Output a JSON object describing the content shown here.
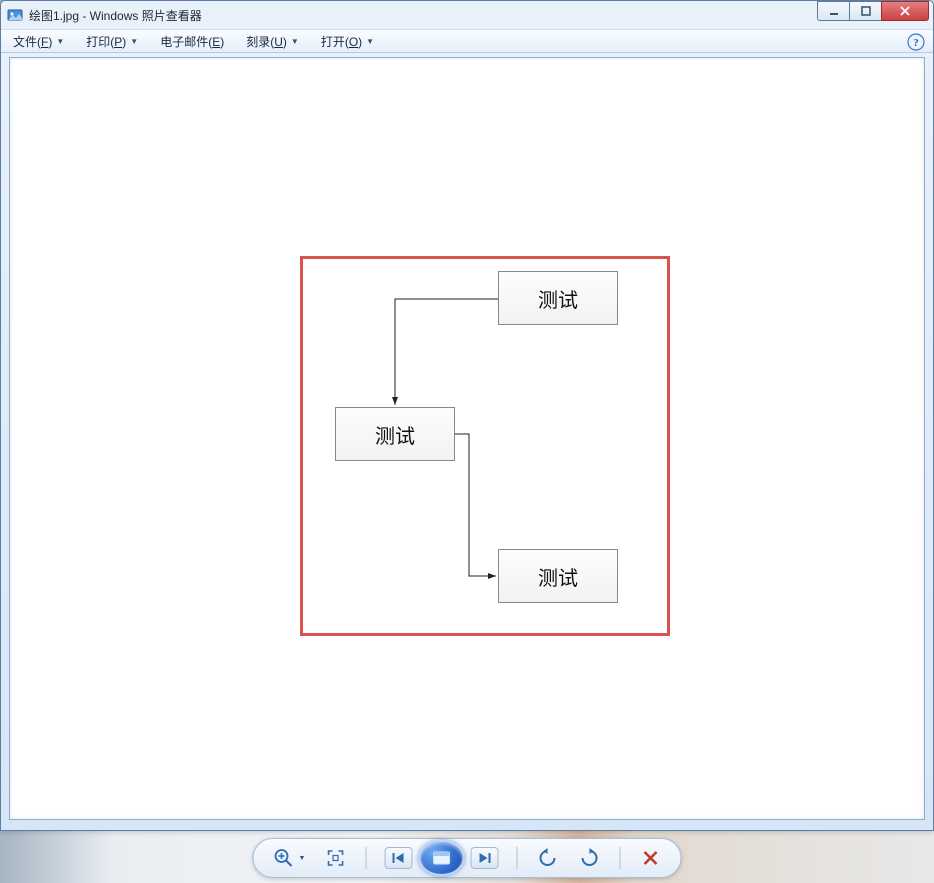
{
  "window": {
    "title": "绘图1.jpg - Windows 照片查看器"
  },
  "menu": {
    "file": {
      "label_pre": "文件(",
      "hotkey": "F",
      "label_post": ")"
    },
    "print": {
      "label_pre": "打印(",
      "hotkey": "P",
      "label_post": ")"
    },
    "email": {
      "label_pre": "电子邮件(",
      "hotkey": "E",
      "label_post": ")"
    },
    "burn": {
      "label_pre": "刻录(",
      "hotkey": "U",
      "label_post": ")"
    },
    "open": {
      "label_pre": "打开(",
      "hotkey": "O",
      "label_post": ")"
    }
  },
  "diagram": {
    "box1": "测试",
    "box2": "测试",
    "box3": "测试"
  },
  "icons": {
    "zoom": "zoom",
    "fit": "fit",
    "prev": "prev",
    "slideshow": "slideshow",
    "next": "next",
    "rotate_ccw": "rotate-ccw",
    "rotate_cw": "rotate-cw",
    "delete": "delete",
    "help": "help"
  }
}
